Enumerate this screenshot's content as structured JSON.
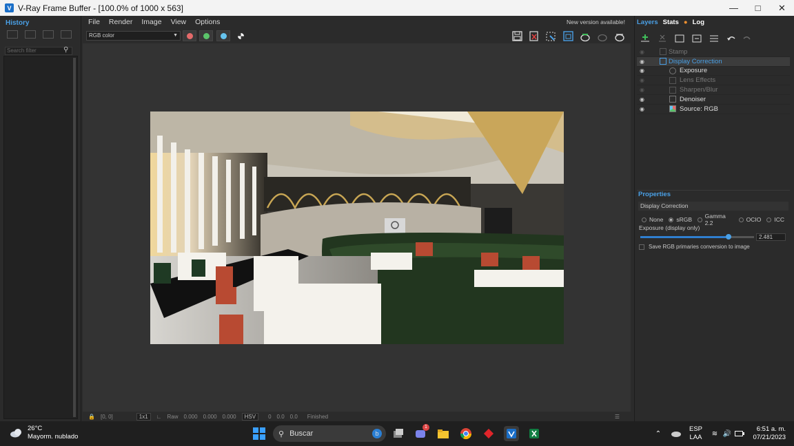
{
  "window": {
    "title": "V-Ray Frame Buffer - [100.0% of 1000 x 563]"
  },
  "history": {
    "tab": "History",
    "search_placeholder": "Search filter"
  },
  "menu": [
    "File",
    "Render",
    "Image",
    "View",
    "Options"
  ],
  "notice": "New version available!",
  "toolbar": {
    "channel": "RGB color",
    "colors": {
      "red": "#e46a6a",
      "green": "#5bc46a",
      "blue": "#66c4ef"
    }
  },
  "right_tabs": {
    "layers": "Layers",
    "stats": "Stats",
    "log": "Log"
  },
  "layers": [
    {
      "label": "Stamp",
      "enabled": false,
      "indent": 0
    },
    {
      "label": "Display Correction",
      "enabled": true,
      "indent": 0,
      "selected": true
    },
    {
      "label": "Exposure",
      "enabled": true,
      "indent": 1
    },
    {
      "label": "Lens Effects",
      "enabled": false,
      "indent": 1
    },
    {
      "label": "Sharpen/Blur",
      "enabled": false,
      "indent": 1
    },
    {
      "label": "Denoiser",
      "enabled": true,
      "indent": 1
    },
    {
      "label": "Source: RGB",
      "enabled": true,
      "indent": 1
    }
  ],
  "properties": {
    "header": "Properties",
    "section": "Display Correction",
    "options": [
      "None",
      "sRGB",
      "Gamma 2.2",
      "OCIO",
      "ICC"
    ],
    "selected_option": "sRGB",
    "exposure_label": "Exposure (display only)",
    "exposure_value": "2.481",
    "exposure_fraction": 0.75,
    "save_label": "Save RGB primaries conversion to image"
  },
  "status": {
    "coords": "[0, 0]",
    "zoom": "1x1",
    "raw": "Raw",
    "r": "0.000",
    "g": "0.000",
    "b": "0.000",
    "mode": "HSV",
    "h": "0",
    "s": "0.0",
    "v": "0.0",
    "state": "Finished"
  },
  "taskbar": {
    "temp": "26°C",
    "weather": "Mayorm. nublado",
    "search": "Buscar",
    "lang1": "ESP",
    "lang2": "LAA",
    "time": "6:51 a. m.",
    "date": "07/21/2023",
    "teams_badge": "1"
  }
}
